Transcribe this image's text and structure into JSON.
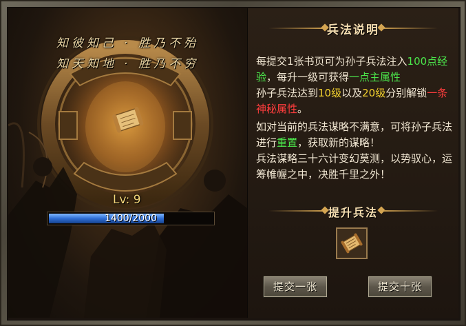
{
  "motto": {
    "line1": "知彼知己 · 胜乃不殆",
    "line2": "知天知地 · 胜乃不穷"
  },
  "level": {
    "label": "Lv:",
    "value": "9",
    "text": "Lv: 9"
  },
  "exp": {
    "current": 1400,
    "max": 2000,
    "text": "1400/2000"
  },
  "panel": {
    "title": "兵法说明",
    "desc": {
      "p1_a": "每提交1张书页可为孙子兵法注入",
      "p1_b": "100点经验",
      "p1_c": "，每升一级可获得",
      "p1_d": "一点主属性",
      "p2_a": "孙子兵法达到",
      "p2_b": "10级",
      "p2_c": "以及",
      "p2_d": "20级",
      "p2_e": "分别解锁",
      "p2_f": "一条神秘属性",
      "p2_g": "。",
      "p3_a": "如对当前的兵法谋略不满意，可将孙子兵法进行",
      "p3_b": "重置",
      "p3_c": "，获取新的谋略！",
      "p4": "兵法谋略三十六计变幻莫测，以势驭心，运筹帷幄之中，决胜千里之外！"
    },
    "upgrade_title": "提升兵法",
    "item_icon": "scroll-icon",
    "buttons": {
      "submit_one": "提交一张",
      "submit_ten": "提交十张"
    }
  },
  "colors": {
    "green": "#4be64b",
    "yellow": "#f3d22f",
    "red": "#ff3d3d",
    "exp_bar": "#2f6fd6"
  }
}
